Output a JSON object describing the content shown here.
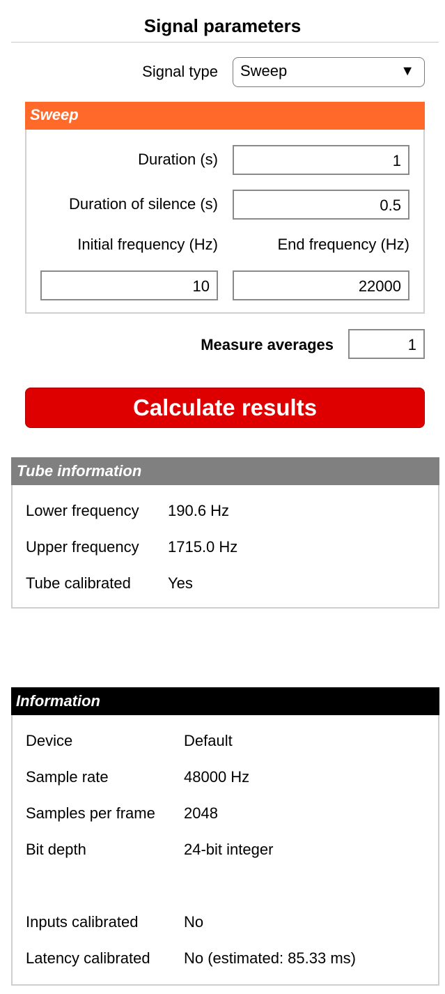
{
  "header": {
    "title": "Signal parameters"
  },
  "signal_type": {
    "label": "Signal type",
    "value": "Sweep",
    "arrow": "▼"
  },
  "sweep": {
    "title": "Sweep",
    "duration_label": "Duration (s)",
    "duration_value": "1",
    "silence_label": "Duration of silence (s)",
    "silence_value": "0.5",
    "initial_freq_label": "Initial frequency (Hz)",
    "initial_freq_value": "10",
    "end_freq_label": "End frequency (Hz)",
    "end_freq_value": "22000"
  },
  "averages": {
    "label": "Measure averages",
    "value": "1"
  },
  "calculate": {
    "label": "Calculate results",
    "color": "#de0000"
  },
  "tube_info": {
    "title": "Tube information",
    "rows": [
      {
        "label": "Lower frequency",
        "value": "190.6 Hz"
      },
      {
        "label": "Upper frequency",
        "value": "1715.0 Hz"
      },
      {
        "label": "Tube calibrated",
        "value": "Yes"
      }
    ]
  },
  "information": {
    "title": "Information",
    "rows": [
      {
        "label": "Device",
        "value": "Default"
      },
      {
        "label": "Sample rate",
        "value": "48000 Hz"
      },
      {
        "label": "Samples per frame",
        "value": "2048"
      },
      {
        "label": "Bit depth",
        "value": "24-bit integer"
      },
      {
        "label": "Inputs calibrated",
        "value": "No"
      },
      {
        "label": "Latency calibrated",
        "value": "No (estimated: 85.33 ms)"
      }
    ]
  },
  "colors": {
    "sweep_header": "#ff6a2a",
    "tube_header": "#808080",
    "info_header": "#000000"
  }
}
